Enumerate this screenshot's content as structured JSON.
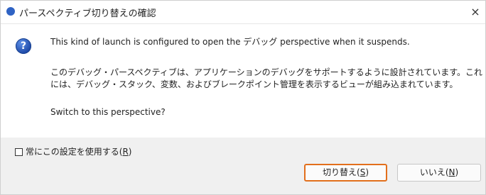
{
  "window": {
    "title": "パースペクティブ切り替えの確認",
    "close_glyph": "×"
  },
  "message": {
    "line1": "This kind of launch is configured to open the デバッグ perspective when it suspends.",
    "line2": "このデバッグ・パースペクティブは、アプリケーションのデバッグをサポートするように設計されています。これには、デバッグ・スタック、変数、およびブレークポイント管理を表示するビューが組み込まれています。",
    "line3": "Switch to this perspective?"
  },
  "checkbox": {
    "label": "常にこの設定を使用する(",
    "mnemonic": "R",
    "suffix": ")",
    "checked": false
  },
  "buttons": {
    "switch": {
      "label": "切り替え(",
      "mnemonic": "S",
      "suffix": ")"
    },
    "no": {
      "label": "いいえ(",
      "mnemonic": "N",
      "suffix": ")"
    }
  },
  "icons": {
    "app": "app-icon",
    "question": "question-icon"
  },
  "colors": {
    "focus_outline": "#e26f1c",
    "question_icon": "#2f63c4"
  }
}
